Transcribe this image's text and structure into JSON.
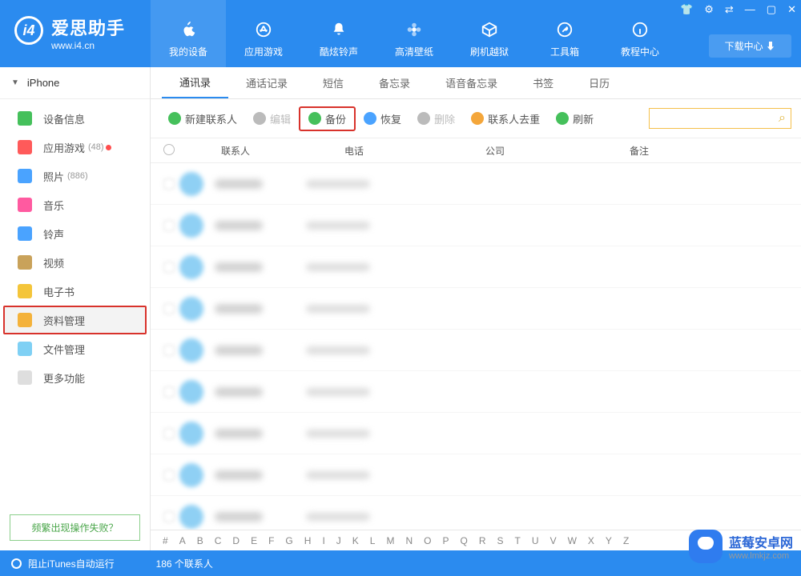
{
  "app": {
    "name": "爱思助手",
    "domain": "www.i4.cn"
  },
  "win_ctrls": [
    "👕",
    "⚙",
    "⇄",
    "—",
    "▢",
    "✕"
  ],
  "download_center": "下载中心  ⬇",
  "top_nav": [
    {
      "label": "我的设备",
      "icon": "apple"
    },
    {
      "label": "应用游戏",
      "icon": "appstore"
    },
    {
      "label": "酷炫铃声",
      "icon": "bell"
    },
    {
      "label": "高清壁纸",
      "icon": "flower"
    },
    {
      "label": "刷机越狱",
      "icon": "box"
    },
    {
      "label": "工具箱",
      "icon": "wrench"
    },
    {
      "label": "教程中心",
      "icon": "info"
    }
  ],
  "device_name": "iPhone",
  "sidebar": [
    {
      "label": "设备信息",
      "color": "#45c05b"
    },
    {
      "label": "应用游戏",
      "color": "#ff5a5a",
      "badge": "(48)",
      "dot": true
    },
    {
      "label": "照片",
      "color": "#4aa3ff",
      "badge": "(886)"
    },
    {
      "label": "音乐",
      "color": "#ff5aa0"
    },
    {
      "label": "铃声",
      "color": "#4aa3ff"
    },
    {
      "label": "视频",
      "color": "#c9a25a"
    },
    {
      "label": "电子书",
      "color": "#f4c53a"
    },
    {
      "label": "资料管理",
      "color": "#f4b23a",
      "highlight": true
    },
    {
      "label": "文件管理",
      "color": "#7fd0f4"
    },
    {
      "label": "更多功能",
      "color": "#dedede"
    }
  ],
  "side_help": "频繁出现操作失败？",
  "subtabs": [
    "通讯录",
    "通话记录",
    "短信",
    "备忘录",
    "语音备忘录",
    "书签",
    "日历"
  ],
  "active_subtab": 0,
  "toolbar": [
    {
      "label": "新建联系人",
      "color": "#45c05b",
      "enabled": true
    },
    {
      "label": "编辑",
      "color": "#bbb",
      "enabled": false
    },
    {
      "label": "备份",
      "color": "#45c05b",
      "enabled": true,
      "highlight": true
    },
    {
      "label": "恢复",
      "color": "#4aa3ff",
      "enabled": true
    },
    {
      "label": "删除",
      "color": "#bbb",
      "enabled": false
    },
    {
      "label": "联系人去重",
      "color": "#f4a63a",
      "enabled": true
    },
    {
      "label": "刷新",
      "color": "#45c05b",
      "enabled": true
    }
  ],
  "table": {
    "headers": [
      "联系人",
      "电话",
      "公司",
      "备注"
    ],
    "row_count": 9
  },
  "alpha_index": [
    "#",
    "A",
    "B",
    "C",
    "D",
    "E",
    "F",
    "G",
    "H",
    "I",
    "J",
    "K",
    "L",
    "M",
    "N",
    "O",
    "P",
    "Q",
    "R",
    "S",
    "T",
    "U",
    "V",
    "W",
    "X",
    "Y",
    "Z"
  ],
  "footer": {
    "left": "阻止iTunes自动运行",
    "count": "186 个联系人"
  },
  "watermark": {
    "title": "蓝莓安卓网",
    "sub": "www.lmkjz.com"
  },
  "search_placeholder": ""
}
